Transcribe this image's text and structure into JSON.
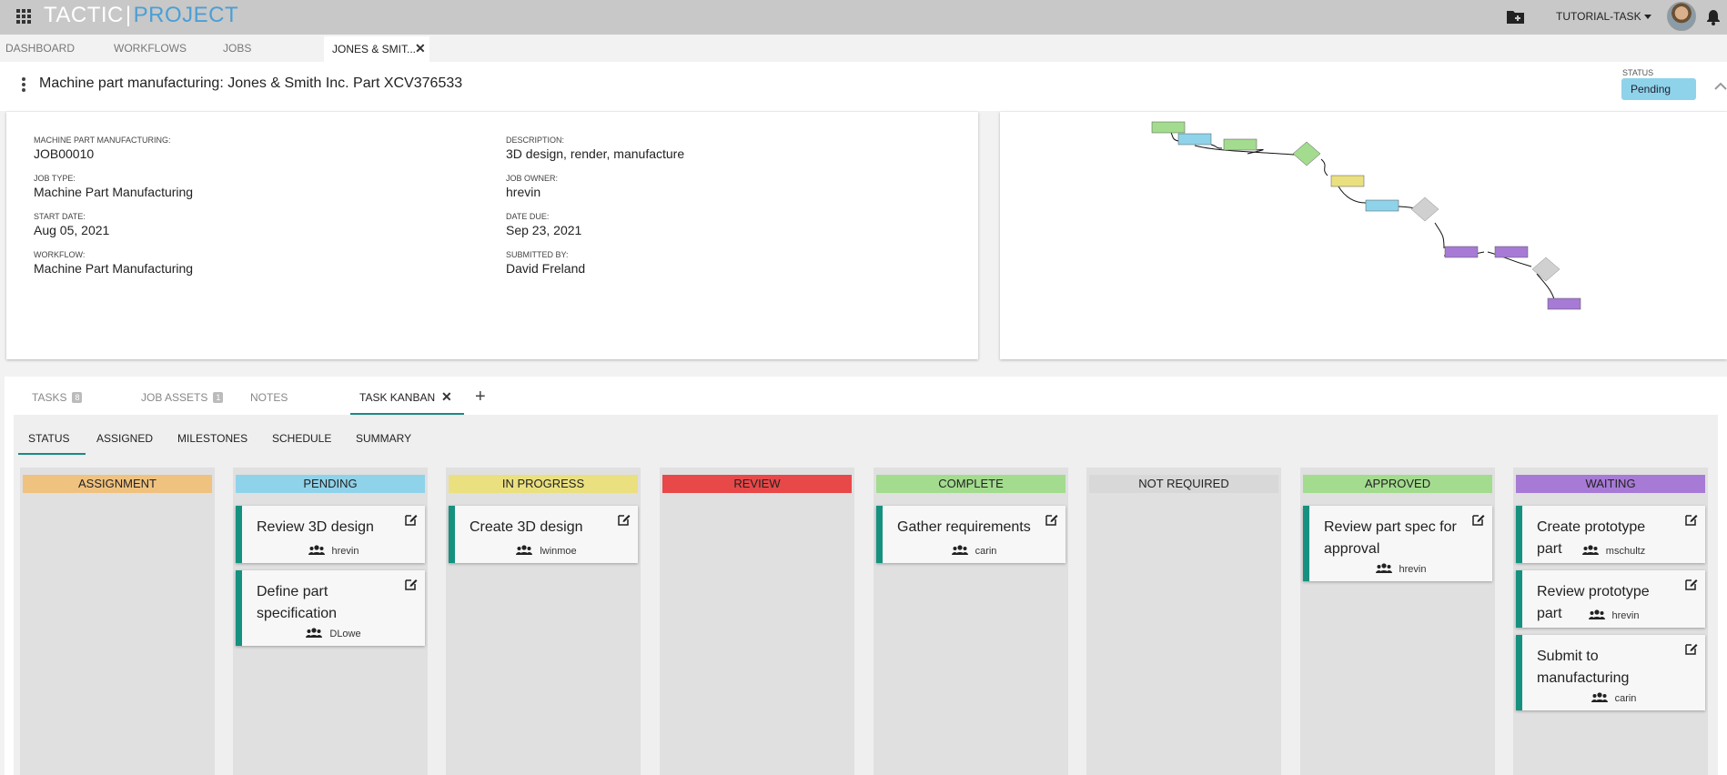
{
  "brand": {
    "part1": "TACTIC",
    "separator": "|",
    "part2": "PROJECT"
  },
  "topbar": {
    "project_menu": "TUTORIAL-TASK"
  },
  "main_tabs": [
    "DASHBOARD",
    "WORKFLOWS",
    "JOBS"
  ],
  "active_tab": {
    "label": "JONES & SMIT...",
    "close": "✕"
  },
  "job": {
    "title": "Machine part manufacturing: Jones & Smith Inc. Part XCV376533",
    "status_label": "STATUS",
    "status_value": "Pending"
  },
  "fields": {
    "left": [
      {
        "label": "MACHINE PART MANUFACTURING:",
        "value": "JOB00010"
      },
      {
        "label": "JOB TYPE:",
        "value": "Machine Part Manufacturing"
      },
      {
        "label": "START DATE:",
        "value": "Aug 05, 2021"
      },
      {
        "label": "WORKFLOW:",
        "value": "Machine Part Manufacturing"
      }
    ],
    "right": [
      {
        "label": "DESCRIPTION:",
        "value": "3D design, render, manufacture"
      },
      {
        "label": "JOB OWNER:",
        "value": "hrevin"
      },
      {
        "label": "DATE DUE:",
        "value": "Sep 23, 2021"
      },
      {
        "label": "SUBMITTED BY:",
        "value": "David Freland"
      }
    ]
  },
  "sub_tabs": [
    {
      "label": "TASKS",
      "badge": "8"
    },
    {
      "label": "JOB ASSETS",
      "badge": "1"
    },
    {
      "label": "NOTES",
      "badge": ""
    },
    {
      "label": "TASK KANBAN",
      "badge": ""
    }
  ],
  "sub_tab_close": "✕",
  "sub_tab_add": "+",
  "view_tabs": [
    "STATUS",
    "ASSIGNED",
    "MILESTONES",
    "SCHEDULE",
    "SUMMARY"
  ],
  "columns": [
    {
      "title": "ASSIGNMENT",
      "color": "#f0c27f",
      "cards": []
    },
    {
      "title": "PENDING",
      "color": "#8fd3ea",
      "cards": [
        {
          "title": "Review 3D design",
          "user": "hrevin"
        },
        {
          "title": "Define part specification",
          "user": "DLowe"
        }
      ]
    },
    {
      "title": "IN PROGRESS",
      "color": "#eae07f",
      "cards": [
        {
          "title": "Create 3D design",
          "user": "lwinmoe"
        }
      ]
    },
    {
      "title": "REVIEW",
      "color": "#e84848",
      "cards": []
    },
    {
      "title": "COMPLETE",
      "color": "#a3dc8e",
      "cards": [
        {
          "title": "Gather requirements",
          "user": "carin"
        }
      ]
    },
    {
      "title": "NOT REQUIRED",
      "color": "#d8d8d8",
      "cards": []
    },
    {
      "title": "APPROVED",
      "color": "#a3dc8e",
      "cards": [
        {
          "title": "Review part spec for approval",
          "user": "hrevin"
        }
      ]
    },
    {
      "title": "WAITING",
      "color": "#a77ad6",
      "cards": [
        {
          "title": "Create prototype part",
          "user": "mschultz"
        },
        {
          "title": "Review prototype part",
          "user": "hrevin"
        },
        {
          "title": "Submit to manufacturing",
          "user": "carin"
        }
      ]
    }
  ],
  "colors": {
    "accent": "#1a8a84",
    "card_bar": "#16917f"
  },
  "icons": [
    "apps-grid-icon",
    "new-folder-icon",
    "caret-down-icon",
    "bell-icon",
    "kebab-menu-icon",
    "chevron-up-icon",
    "edit-icon",
    "users-icon",
    "close-icon",
    "add-icon"
  ]
}
